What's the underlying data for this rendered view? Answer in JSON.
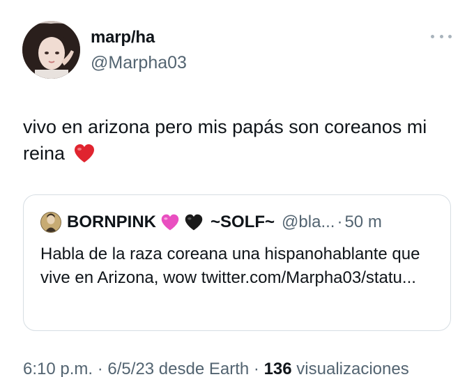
{
  "author": {
    "name": "marp/ha",
    "handle": "@Marpha03"
  },
  "tweet": {
    "text": "vivo en arizona pero mis papás son coreanos mi reina"
  },
  "quoted": {
    "name": "BORNPINK",
    "name_suffix": "~SOLF~",
    "handle": "@bla...",
    "separator": "·",
    "time": "50 m",
    "text": "Habla de la raza coreana una hispanohablante que vive en Arizona, wow twitter.com/Marpha03/statu..."
  },
  "meta": {
    "time": "6:10 p.m.",
    "sep1": "·",
    "date_source": "6/5/23 desde Earth",
    "sep2": "·",
    "views_count": "136",
    "views_label": "visualizaciones"
  },
  "icons": {
    "more": "more-dots-icon",
    "heart": "red-heart-emoji",
    "pink_heart": "pink-heart-emoji",
    "black_heart": "black-heart-emoji"
  },
  "colors": {
    "text": "#0f1419",
    "secondary": "#536471",
    "border": "#d6dde3",
    "heart": "#e0242f",
    "pink_heart": "#e94fc0"
  }
}
